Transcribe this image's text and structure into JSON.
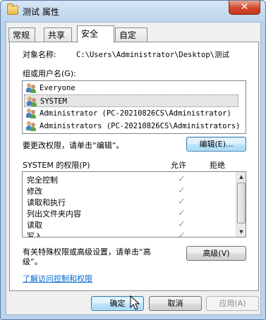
{
  "window": {
    "title": "测试 属性",
    "close_glyph": "✕"
  },
  "tabs": [
    "常规",
    "共享",
    "安全",
    "自定义"
  ],
  "security": {
    "object_label": "对象名称:",
    "object_value": "C:\\Users\\Administrator\\Desktop\\测试",
    "group_label": "组或用户名(G):",
    "users": [
      "Everyone",
      "SYSTEM",
      "Administrator (PC-20210826CS\\Administrator)",
      "Administrators (PC-20210826CS\\Administrators)"
    ],
    "change_text": "要更改权限，请单击“编辑”。",
    "edit_button": "编辑(E)...",
    "perm_label": "SYSTEM 的权限(P)",
    "allow_header": "允许",
    "deny_header": "拒绝",
    "permissions": [
      "完全控制",
      "修改",
      "读取和执行",
      "列出文件夹内容",
      "读取",
      "写入"
    ],
    "check_glyph": "✓",
    "special_text_1": "有关特殊权限或高级设置，请单击“高",
    "special_text_2": "级”。",
    "advanced_button": "高级(V)",
    "learn_link": "了解访问控制和权限"
  },
  "footer": {
    "ok": "确定",
    "cancel": "取消",
    "apply": "应用(A)"
  }
}
